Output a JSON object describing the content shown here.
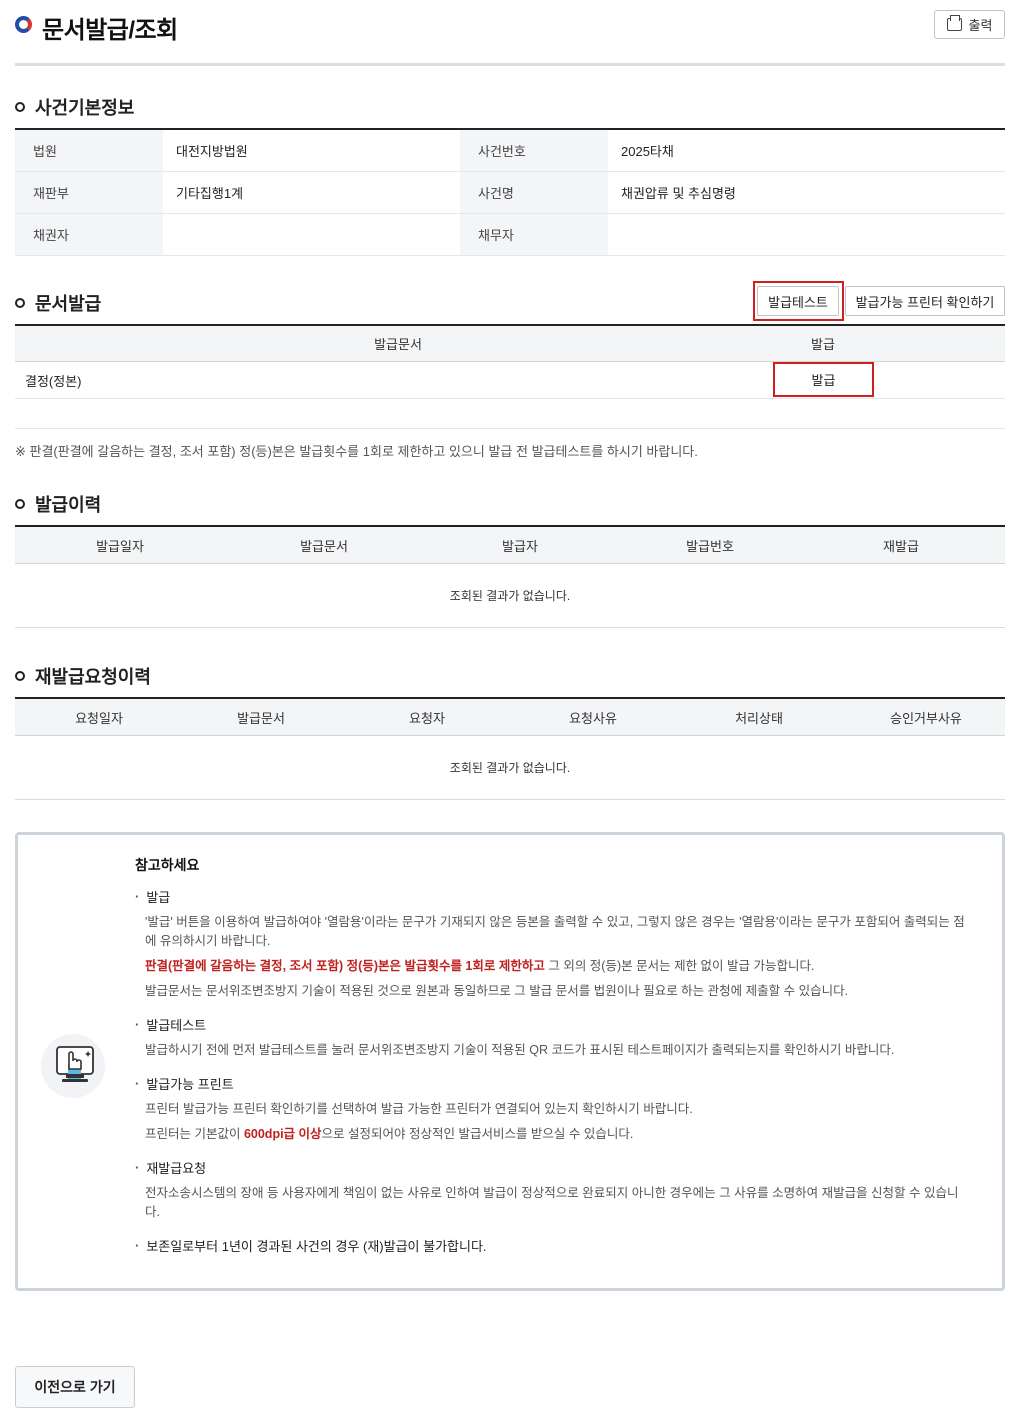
{
  "header": {
    "title": "문서발급/조회",
    "print_label": "출력"
  },
  "case_info": {
    "title": "사건기본정보",
    "rows": [
      {
        "label1": "법원",
        "value1": "대전지방법원",
        "label2": "사건번호",
        "value2": "2025타채"
      },
      {
        "label1": "재판부",
        "value1": "기타집행1계",
        "label2": "사건명",
        "value2": "채권압류 및 추심명령"
      },
      {
        "label1": "채권자",
        "value1": "",
        "label2": "채무자",
        "value2": ""
      }
    ]
  },
  "issuance": {
    "title": "문서발급",
    "test_button": "발급테스트",
    "printer_button": "발급가능 프린터 확인하기",
    "col_doc": "발급문서",
    "col_issue": "발급",
    "row_doc": "결정(정본)",
    "issue_button": "발급",
    "notice": "※ 판결(판결에 갈음하는 결정, 조서 포함) 정(등)본은 발급횟수를 1회로 제한하고 있으니 발급 전 발급테스트를 하시기 바랍니다."
  },
  "history": {
    "title": "발급이력",
    "columns": [
      "발급일자",
      "발급문서",
      "발급자",
      "발급번호",
      "재발급"
    ],
    "empty": "조회된 결과가 없습니다."
  },
  "reissue": {
    "title": "재발급요청이력",
    "columns": [
      "요청일자",
      "발급문서",
      "요청자",
      "요청사유",
      "처리상태",
      "승인거부사유"
    ],
    "empty": "조회된 결과가 없습니다."
  },
  "guide": {
    "title": "참고하세요",
    "issue_title": "발급",
    "issue_desc1": "'발급' 버튼을 이용하여 발급하여야 '열람용'이라는 문구가 기재되지 않은 등본을 출력할 수 있고, 그렇지 않은 경우는 '열람용'이라는 문구가 포함되어 출력되는 점에 유의하시기 바랍니다.",
    "issue_desc2_red": "판결(판결에 갈음하는 결정, 조서 포함) 정(등)본은 발급횟수를 1회로 제한하고",
    "issue_desc2_rest": " 그 외의 정(등)본 문서는 제한 없이 발급 가능합니다.",
    "issue_desc3": "발급문서는 문서위조변조방지 기술이 적용된 것으로 원본과 동일하므로 그 발급 문서를 법원이나 필요로 하는 관청에 제출할 수 있습니다.",
    "test_title": "발급테스트",
    "test_desc": "발급하시기 전에 먼저 발급테스트를 눌러 문서위조변조방지 기술이 적용된 QR 코드가 표시된 테스트페이지가 출력되는지를 확인하시기 바랍니다.",
    "printer_title": "발급가능 프린트",
    "printer_desc1": "프린터 발급가능 프린터 확인하기를 선택하여 발급 가능한 프린터가 연결되어 있는지 확인하시기 바랍니다.",
    "printer_desc2_pre": "프린터는 기본값이 ",
    "printer_desc2_red": "600dpi급 이상",
    "printer_desc2_post": "으로 설정되어야 정상적인 발급서비스를 받으실 수 있습니다.",
    "reissue_title": "재발급요청",
    "reissue_desc": "전자소송시스템의 장애 등 사용자에게 책임이 없는 사유로 인하여 발급이 정상적으로 완료되지 아니한 경우에는 그 사유를 소명하여 재발급을 신청할 수 있습니다.",
    "retention_title": "보존일로부터 1년이 경과된 사건의 경우 (재)발급이 불가합니다."
  },
  "footer": {
    "back_label": "이전으로 가기"
  },
  "colors": {
    "accent_blue": "#1f4fa8",
    "accent_red": "#d6332b",
    "highlight": "#d11f1f"
  }
}
